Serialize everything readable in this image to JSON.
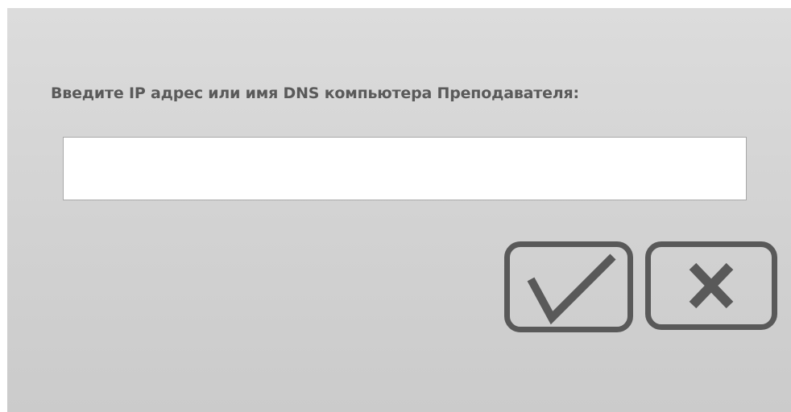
{
  "dialog": {
    "prompt": "Введите IP адрес или имя DNS компьютера Преподавателя:",
    "input_value": "",
    "input_placeholder": ""
  },
  "buttons": {
    "ok_icon": "checkmark-icon",
    "cancel_icon": "close-icon"
  },
  "colors": {
    "background_top": "#dcdcdc",
    "background_bottom": "#cbcbcb",
    "text": "#5a5a5a",
    "icon": "#595959",
    "input_background": "#ffffff",
    "input_border": "#a8a8a8"
  }
}
